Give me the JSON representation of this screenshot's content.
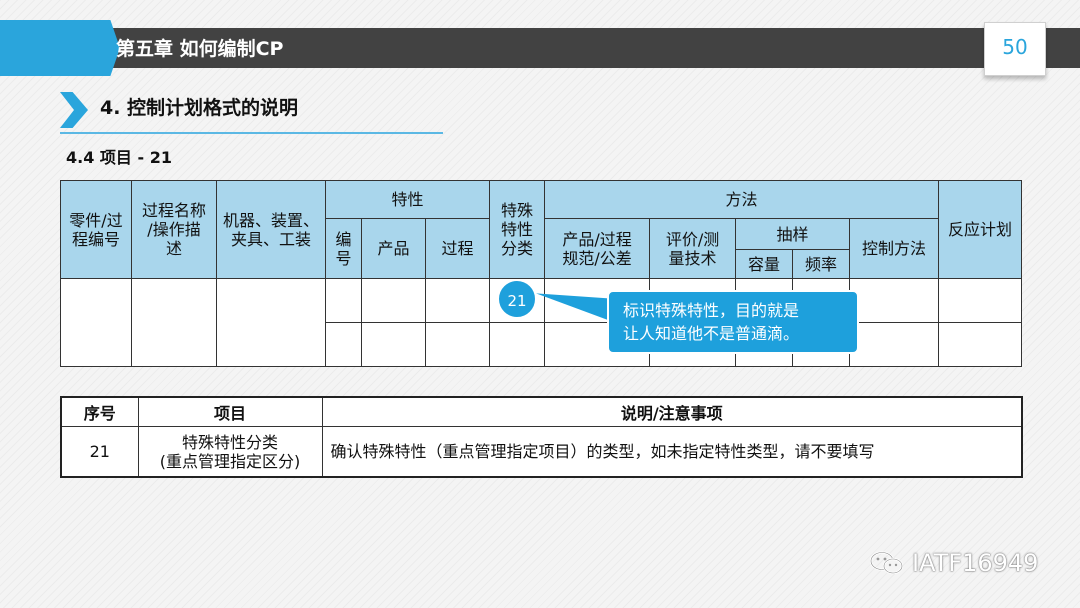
{
  "header": {
    "chapter_title": "第五章  如何编制CP",
    "page_number": "50",
    "accent_color": "#2aa5dc",
    "bar_color": "#424242"
  },
  "section": {
    "title": "4. 控制计划格式的说明",
    "subtitle": "4.4 项目 - 21"
  },
  "control_plan_table": {
    "header_color": "#a9d6ec",
    "part_process_no": [
      "零件/过",
      "程编号"
    ],
    "process_name": [
      "过程名称",
      "/操作描",
      "述"
    ],
    "machine_device": [
      "机器、装置、",
      "夹具、工装"
    ],
    "characteristics": "特性",
    "char_no": [
      "编",
      "号"
    ],
    "char_product": "产品",
    "char_process": "过程",
    "special_char_class": [
      "特殊",
      "特性",
      "分类"
    ],
    "methods": "方法",
    "spec_tolerance": [
      "产品/过程",
      "规范/公差"
    ],
    "evaluation_technique": [
      "评价/测",
      "量技术"
    ],
    "sample": "抽样",
    "sample_size": "容量",
    "sample_freq": "频率",
    "control_method": "控制方法",
    "reaction_plan": "反应计划"
  },
  "callout": {
    "badge": "21",
    "text_line1": "标识特殊特性，目的就是",
    "text_line2": "让人知道他不是普通滴。"
  },
  "item_table": {
    "col_no": "序号",
    "col_item": "项目",
    "col_desc": "说明/注意事项",
    "row_no": "21",
    "row_item_line1": "特殊特性分类",
    "row_item_line2": "(重点管理指定区分)",
    "row_desc": "确认特殊特性（重点管理指定项目）的类型，如未指定特性类型，请不要填写"
  },
  "watermark": {
    "icon": "wechat-icon",
    "text": "IATF16949"
  }
}
